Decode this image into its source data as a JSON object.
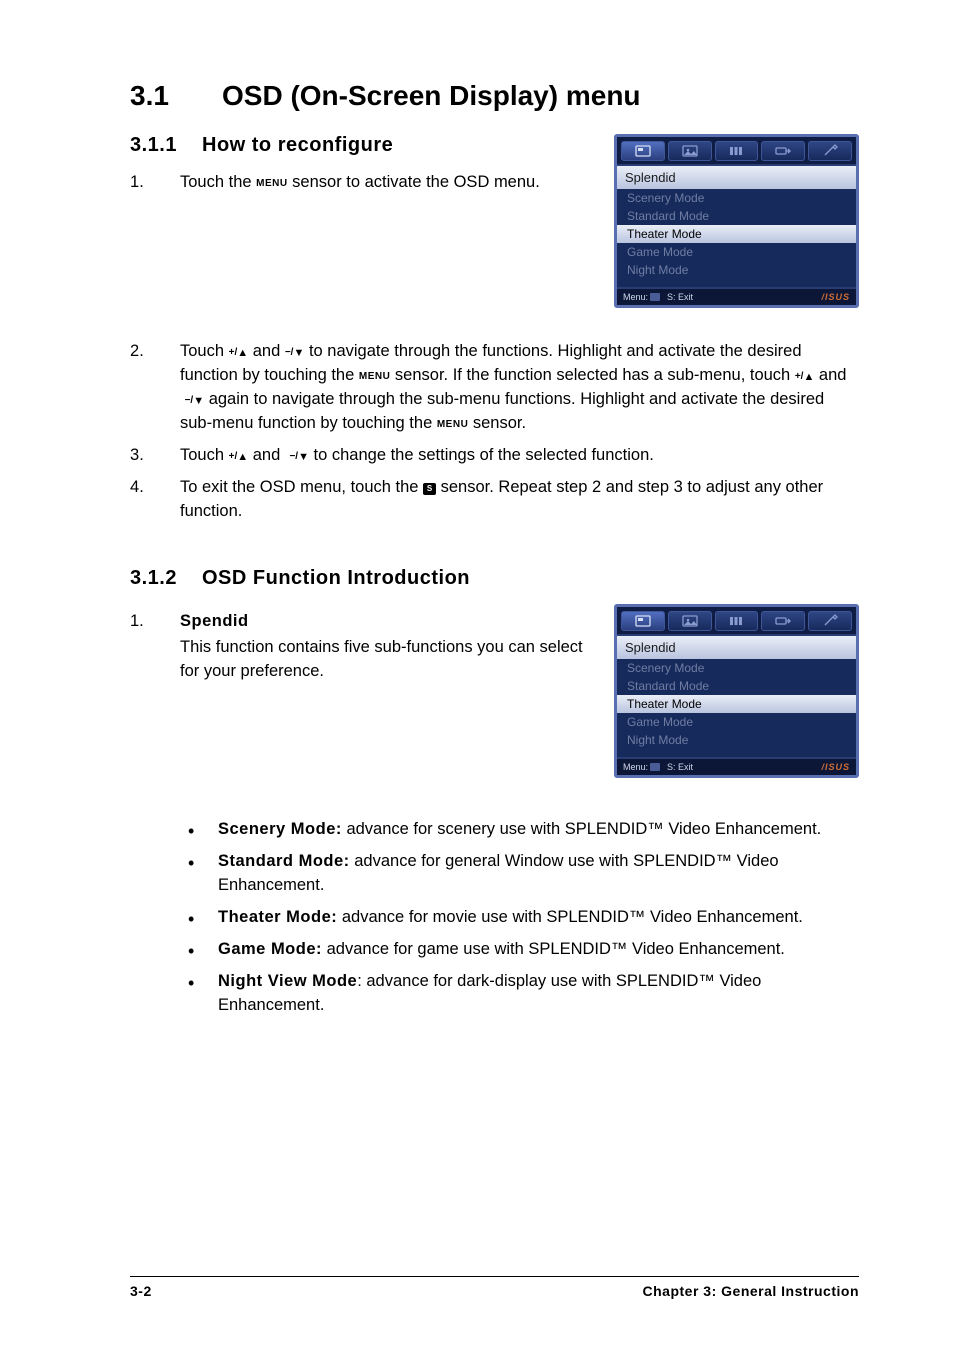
{
  "heading": {
    "num": "3.1",
    "title": "OSD (On-Screen Display) menu"
  },
  "sec311": {
    "num": "3.1.1",
    "title": "How to reconfigure",
    "step1_a": "Touch the ",
    "step1_menu": "MENU",
    "step1_b": " sensor to activate the OSD menu.",
    "step2_a": "Touch ",
    "plus": "+/",
    "up": "▲",
    "and": " and ",
    "minus": "−/",
    "down": "▼",
    "step2_b": " to navigate through the functions. Highlight and activate the desired function by touching the ",
    "step2_c": " sensor. If the function selected has a sub-menu, touch ",
    "step2_d": " again to navigate through the sub-menu functions. Highlight and activate the desired sub-menu function by touching the ",
    "step2_e": " sensor.",
    "step3_a": "Touch ",
    "step3_b": " to change the settings of the selected function.",
    "step4_a": "To exit the OSD menu, touch the ",
    "step4_s": "S",
    "step4_b": " sensor. Repeat step 2 and step 3 to adjust any other function."
  },
  "sec312": {
    "num": "3.1.2",
    "title": "OSD Function Introduction",
    "item1_num": "1.",
    "item1_title": "Spendid",
    "item1_body": "This function contains five sub-functions you can select for your preference.",
    "modes": [
      {
        "t": "Scenery Mode:",
        "d": " advance for scenery use with SPLENDID™ Video Enhancement."
      },
      {
        "t": "Standard Mode:",
        "d": " advance for general Window use with SPLENDID™ Video Enhancement."
      },
      {
        "t": "Theater Mode:",
        "d": " advance for movie use with SPLENDID™ Video Enhancement."
      },
      {
        "t": "Game Mode:",
        "d": " advance for game use with SPLENDID™ Video Enhancement."
      },
      {
        "t": "Night View Mode",
        "d": ": advance for dark-display use with SPLENDID™ Video Enhancement."
      }
    ]
  },
  "osd": {
    "title": "Splendid",
    "items": [
      "Scenery Mode",
      "Standard Mode",
      "Theater Mode",
      "Game Mode",
      "Night Mode"
    ],
    "selected": "Theater Mode",
    "foot_menu_label": "Menu:",
    "foot_exit": "S: Exit",
    "brand": "/ISUS"
  },
  "footer": {
    "left": "3-2",
    "right": "Chapter 3: General Instruction"
  }
}
